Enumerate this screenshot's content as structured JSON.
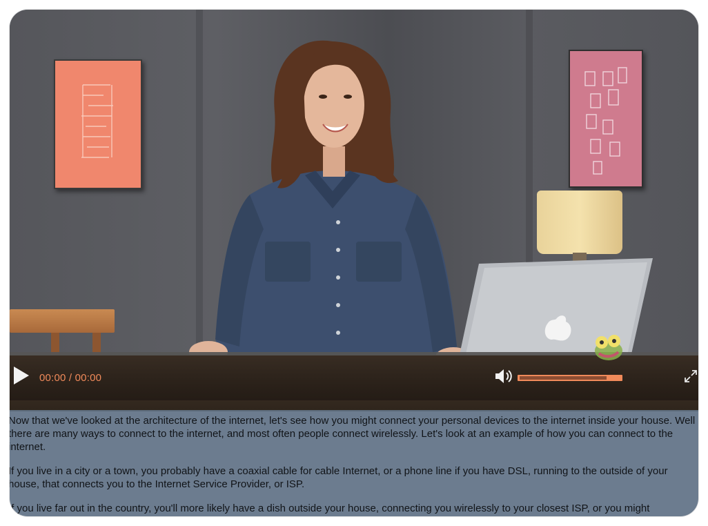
{
  "player": {
    "time_display": "00:00 / 00:00",
    "volume_level": 0.86,
    "progress": 0,
    "accent_color": "#f08a5a",
    "icons": {
      "play": "play-icon",
      "volume": "volume-icon",
      "fullscreen": "fullscreen-icon",
      "logo": "treehouse-frog-icon"
    }
  },
  "transcript": {
    "paragraphs": [
      "Now that we've looked at the architecture of the internet, let's see how you might connect your personal devices to the internet inside your house. Well there are many ways to connect to the internet, and most often people connect wirelessly. Let's look at an example of how you can connect to the internet.",
      "If you live in a city or a town, you probably have a coaxial cable for cable Internet, or a phone line if you have DSL, running to the outside of your house, that connects you to the Internet Service Provider, or ISP.",
      "If you live far out in the country, you'll more likely have a dish outside your house, connecting you wirelessly to your closest ISP, or you might"
    ]
  }
}
